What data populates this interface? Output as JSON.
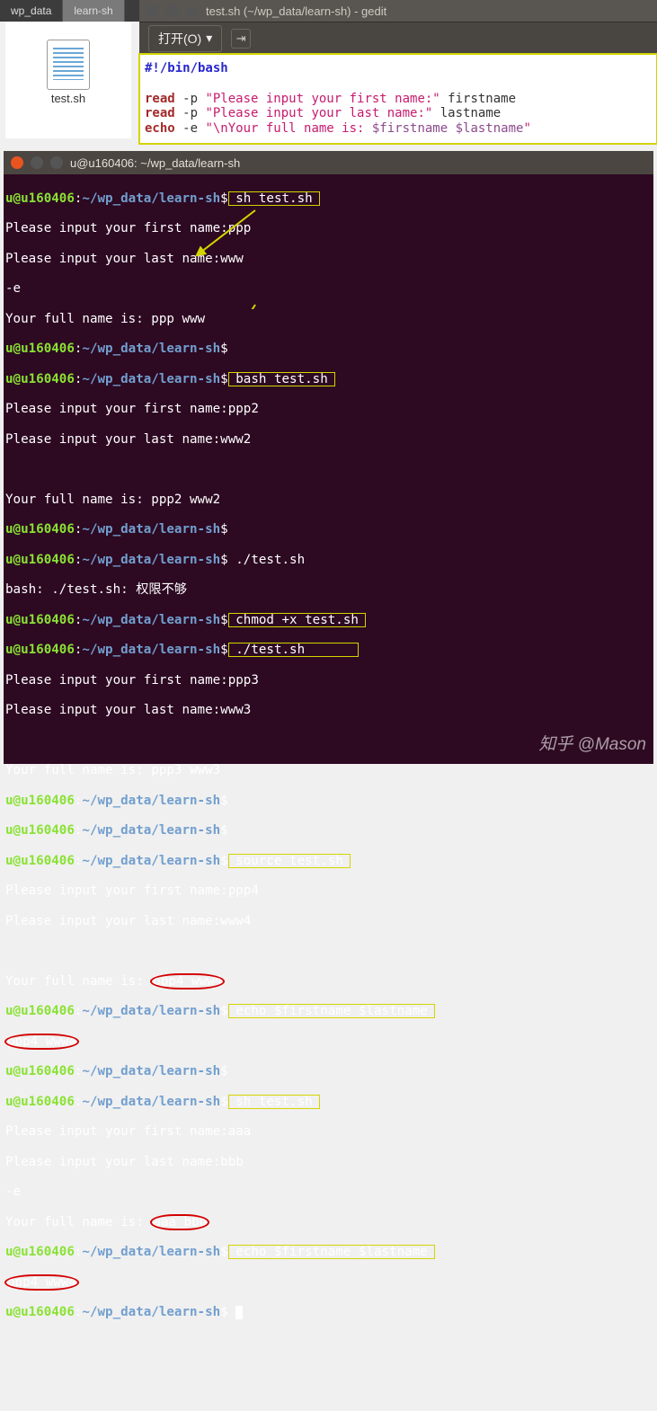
{
  "tabs": {
    "wp_data": "wp_data",
    "learn_sh": "learn-sh"
  },
  "gedit": {
    "title": "test.sh (~/wp_data/learn-sh) - gedit",
    "open_label": "打开(O)",
    "code_lines": {
      "shebang": "#!/bin/bash",
      "read1_kw": "read",
      "read1_opt": " -p ",
      "read1_str": "\"Please input your first name:\"",
      "read1_var": " firstname",
      "read2_kw": "read",
      "read2_opt": " -p ",
      "read2_str": "\"Please input your last name:\"",
      "read2_var": " lastname",
      "echo_kw": "echo",
      "echo_opt": " -e ",
      "echo_str1": "\"\\nYour full name is: ",
      "echo_var": "$firstname $lastname",
      "echo_str2": "\""
    }
  },
  "file": {
    "name": "test.sh"
  },
  "term": {
    "title": "u@u160406: ~/wp_data/learn-sh",
    "prompt_user": "u@u160406",
    "prompt_path": "~/wp_data/learn-sh",
    "colon": ":",
    "dollar": "$",
    "cmd_sh": " sh test.sh ",
    "out1a": "Please input your first name:ppp",
    "out1b": "Please input your last name:www",
    "out1c": "-e",
    "out1d": "Your full name is: ppp www",
    "cmd_bash": " bash test.sh ",
    "out2a": "Please input your first name:ppp2",
    "out2b": "Please input your last name:www2",
    "out2d": "Your full name is: ppp2 www2",
    "cmd_exec": " ./test.sh",
    "out3err": "bash: ./test.sh: 权限不够",
    "cmd_chmod": " chmod +x test.sh ",
    "cmd_exec2": " ./test.sh       ",
    "out3a": "Please input your first name:ppp3",
    "out3b": "Please input your last name:www3",
    "out3d": "Your full name is: ppp3 www3",
    "cmd_source": " source test.sh ",
    "out4a": "Please input your first name:ppp4",
    "out4b": "Please input your last name:www4",
    "out4d_pre": "Your full name is: ",
    "out4d_hl": "ppp4 www4",
    "cmd_echo": " echo $firstname $lastname ",
    "out_echo1": "ppp4 www4",
    "cmd_sh2": " sh test.sh ",
    "out5a": "Please input your first name:aaa",
    "out5b": "Please input your last name:bbb",
    "out5c": "-e",
    "out5d_pre": "Your full name is: ",
    "out5d_hl": "aaa bbb",
    "cmd_echo2": " echo $firstname $lastname ",
    "out_echo2": "ppp4 www4"
  },
  "watermark": "知乎 @Mason"
}
